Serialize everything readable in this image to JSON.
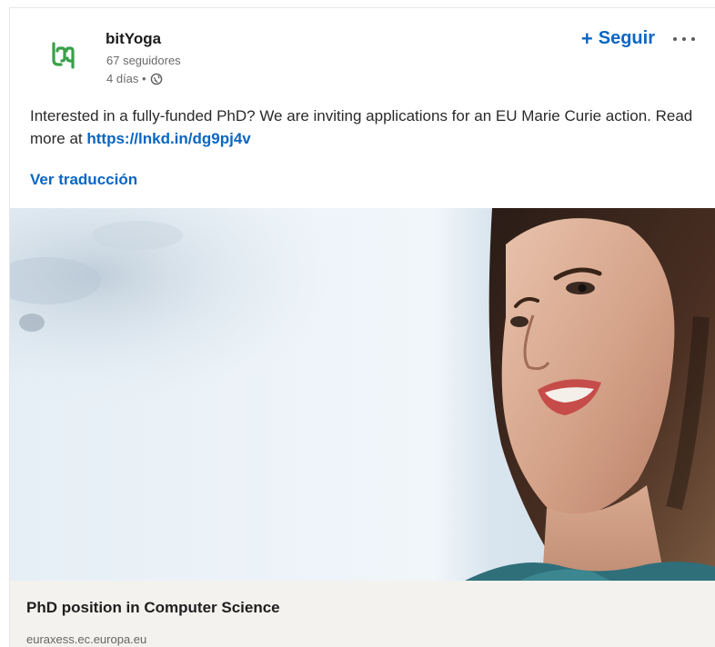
{
  "post": {
    "author": {
      "name": "bitYoga",
      "followers": "67 seguidores",
      "age": "4 días •",
      "logo_icon": "bityoga-logo-icon",
      "visibility_icon": "globe-icon"
    },
    "actions": {
      "follow_plus": "+",
      "follow_label": "Seguir",
      "more_icon": "more-horizontal-icon"
    },
    "text": {
      "body": "Interested in a fully-funded PhD? We are inviting applications for an EU Marie Curie action. Read more at ",
      "link": "https://lnkd.in/dg9pj4v"
    },
    "translate_label": "Ver traducción",
    "preview": {
      "title": "PhD position in Computer Science",
      "domain": "euraxess.ec.europa.eu"
    }
  },
  "colors": {
    "link": "#0a66c2",
    "footer_bg": "#f3f2ef",
    "logo_green": "#39a04a"
  }
}
